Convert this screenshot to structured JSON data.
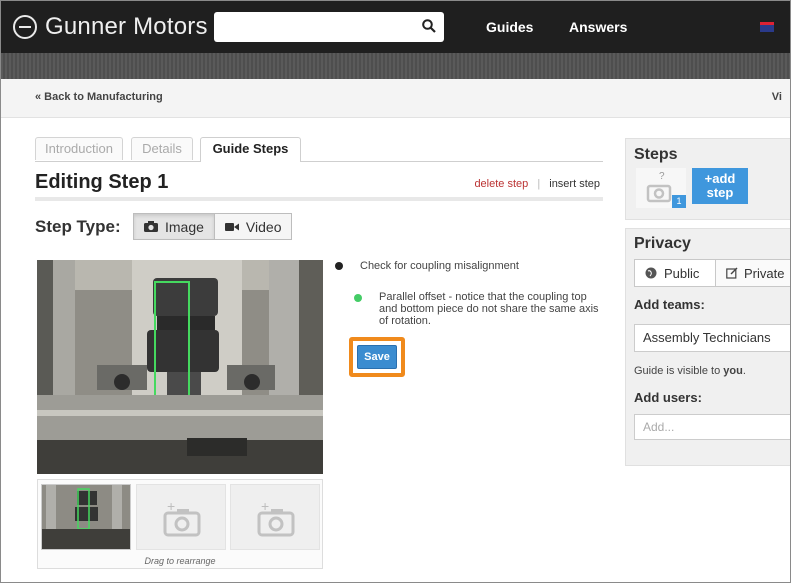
{
  "header": {
    "brand": "Gunner Motors",
    "search_placeholder": "",
    "nav": [
      "Guides",
      "Answers"
    ]
  },
  "crumb": {
    "back": "« Back to Manufacturing",
    "right": "Vi"
  },
  "tabs": [
    {
      "label": "Introduction",
      "active": false
    },
    {
      "label": "Details",
      "active": false
    },
    {
      "label": "Guide Steps",
      "active": true
    }
  ],
  "editor": {
    "title": "Editing Step 1",
    "delete_step": "delete step",
    "separator": "|",
    "insert_step": "insert step",
    "step_type_label": "Step Type:",
    "step_types": [
      {
        "label": "Image",
        "icon": "camera-icon",
        "selected": true
      },
      {
        "label": "Video",
        "icon": "video-camera-icon",
        "selected": false
      }
    ]
  },
  "bullets": [
    {
      "text": "Check for coupling misalignment",
      "color": "#222222"
    },
    {
      "text": "Parallel offset - notice that the coupling top and bottom piece do not share the same axis of rotation.",
      "color": "#44cc66"
    }
  ],
  "save_label": "Save",
  "thumbs": {
    "drag_hint": "Drag to rearrange"
  },
  "sidebar": {
    "steps": {
      "title": "Steps",
      "thumb_placeholder": "?",
      "step_number": "1",
      "add_step_line1": "+add",
      "add_step_line2": "step"
    },
    "privacy": {
      "title": "Privacy",
      "public_label": "Public",
      "private_label": "Private",
      "add_teams_label": "Add teams:",
      "team_value": "Assembly Technicians",
      "visible_prefix": "Guide is visible to ",
      "visible_who": "you",
      "visible_suffix": ".",
      "add_users_label": "Add users:",
      "add_users_placeholder": "Add..."
    }
  },
  "colors": {
    "accent_blue": "#3b8cd0",
    "highlight_orange": "#f08a1c",
    "delete_red": "#b33333",
    "header_bg": "#1f1f1f"
  }
}
